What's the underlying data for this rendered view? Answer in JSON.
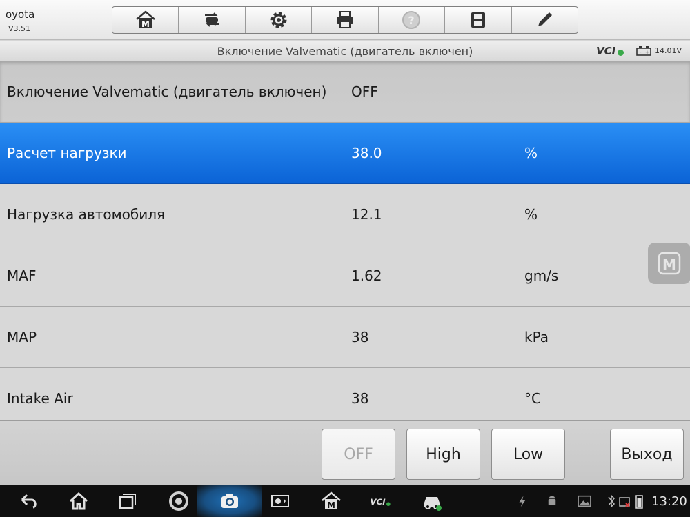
{
  "app": {
    "name": "oyota",
    "version": "V3.51"
  },
  "toolbar": {
    "buttons": [
      {
        "name": "home-m-icon"
      },
      {
        "name": "car-swap-icon"
      },
      {
        "name": "settings-gear-icon"
      },
      {
        "name": "printer-icon"
      },
      {
        "name": "help-icon"
      },
      {
        "name": "save-disk-icon"
      },
      {
        "name": "pen-edit-icon"
      }
    ]
  },
  "titlebar": {
    "title": "Включение Valvematic (двигатель включен)",
    "vci": "VCI",
    "voltage": "14.01V"
  },
  "table": {
    "rows": [
      {
        "name": "Включение Valvematic (двигатель включен)",
        "value": "OFF",
        "unit": ""
      },
      {
        "name": "Расчет нагрузки",
        "value": "38.0",
        "unit": "%"
      },
      {
        "name": "Нагрузка автомобиля",
        "value": "12.1",
        "unit": "%"
      },
      {
        "name": "MAF",
        "value": "1.62",
        "unit": "gm/s"
      },
      {
        "name": "MAP",
        "value": "38",
        "unit": "kPa"
      },
      {
        "name": "Intake Air",
        "value": "38",
        "unit": "°C"
      }
    ],
    "selected_index": 1
  },
  "actions": {
    "off": "OFF",
    "high": "High",
    "low": "Low",
    "exit": "Выход"
  },
  "navbar": {
    "clock": "13:20",
    "icons": [
      "back-icon",
      "home-icon",
      "recent-apps-icon",
      "chrome-icon",
      "camera-icon",
      "brightness-icon",
      "maxisys-icon",
      "vci-icon",
      "car-check-icon"
    ]
  },
  "colors": {
    "selected_top": "#2a8ff5",
    "selected_bottom": "#0b63d6",
    "row_bg": "#d8d8d8"
  }
}
